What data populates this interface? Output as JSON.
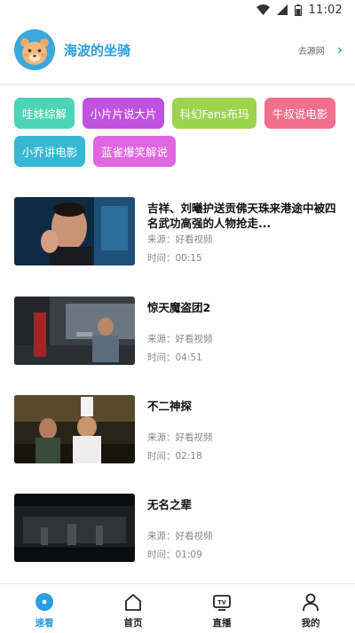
{
  "status_bar": {
    "time": "11:02"
  },
  "header": {
    "title": "海波的坐骑",
    "source_link": "去源网"
  },
  "categories": [
    {
      "label": "哇妹综解",
      "color": "#4cd4b6"
    },
    {
      "label": "小片片说大片",
      "color": "#c052e0"
    },
    {
      "label": "科幻Fans布玛",
      "color": "#9cd44e"
    },
    {
      "label": "牛叔说电影",
      "color": "#f0708c"
    },
    {
      "label": "小乔讲电影",
      "color": "#37b8d2"
    },
    {
      "label": "蓝雀爆笑解说",
      "color": "#e066e4"
    }
  ],
  "videos": [
    {
      "title": "吉祥、刘曦护送贡佛天珠来港途中被四名武功高强的人物抢走...",
      "source": "来源：好看视频",
      "time": "时间：00:15"
    },
    {
      "title": "惊天魔盗团2",
      "source": "来源：好看视频",
      "time": "时间：04:51"
    },
    {
      "title": "不二神探",
      "source": "来源：好看视频",
      "time": "时间：02:18"
    },
    {
      "title": "无名之辈",
      "source": "来源：好看视频",
      "time": "时间：01:09"
    }
  ],
  "nav": {
    "items": [
      {
        "label": "速看",
        "icon": "compass-icon",
        "active": true
      },
      {
        "label": "首页",
        "icon": "home-icon",
        "active": false
      },
      {
        "label": "直播",
        "icon": "tv-icon",
        "active": false
      },
      {
        "label": "我的",
        "icon": "user-icon",
        "active": false
      }
    ],
    "accent": "#2a9de0"
  }
}
